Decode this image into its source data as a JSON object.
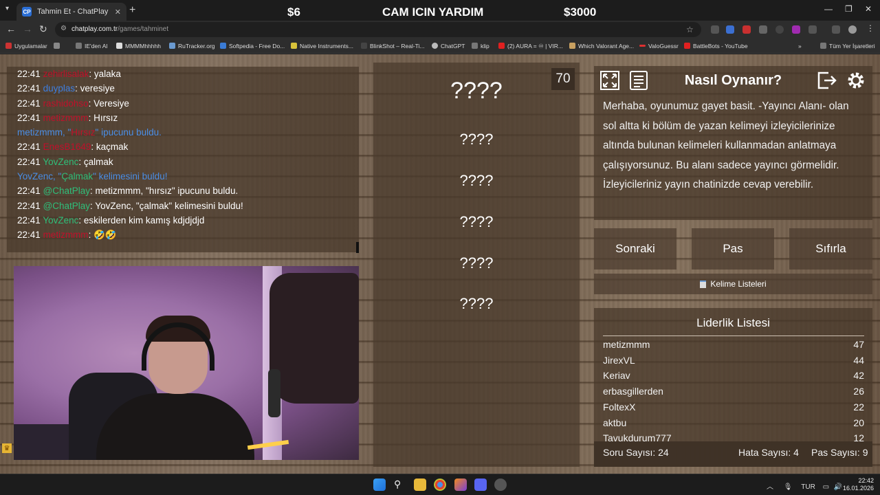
{
  "browser": {
    "tab_title": "Tahmin Et - ChatPlay",
    "tab_favicon": "CP",
    "url_host": "chatplay.com.tr",
    "url_path": "/games/tahminet",
    "bookmarks": [
      "Uygulamalar",
      "IE'den Al",
      "MMMMhhhhh",
      "RuTracker.org",
      "Softpedia - Free Do...",
      "Native Instruments...",
      "BlinkShot – Real-Ti...",
      "ChatGPT",
      "klip",
      "(2) AURA = ♾ | VIR...",
      "Which Valorant Age...",
      "ValoGuessr",
      "BattleBots - YouTube",
      "Tüm Yer İşaretleri"
    ]
  },
  "stream_overlay": {
    "left": "$6",
    "center": "CAM ICIN YARDIM",
    "right": "$3000"
  },
  "chat": [
    {
      "time": "22:41",
      "user": "zehirlisalak",
      "user_color": "#c0102a",
      "text": ": yalaka"
    },
    {
      "time": "22:41",
      "user": "duyplas",
      "user_color": "#3d7ee0",
      "text": ": veresiye"
    },
    {
      "time": "22:41",
      "user": "rashidohso",
      "user_color": "#c0102a",
      "text": ": Veresiye"
    },
    {
      "time": "22:41",
      "user": "metizmmm",
      "user_color": "#c0102a",
      "text": ": Hırsız"
    },
    {
      "system": true,
      "parts": [
        "metizmmm, \"",
        "Hırsız",
        "\" ipucunu buldu."
      ]
    },
    {
      "time": "22:41",
      "user": "EnesB1649",
      "user_color": "#c0102a",
      "text": ": kaçmak"
    },
    {
      "time": "22:41",
      "user": "YovZenc",
      "user_color": "#2fbf7a",
      "text": ": çalmak"
    },
    {
      "system": true,
      "parts": [
        "YovZenc, \"",
        "Çalmak",
        "\" kelimesini buldu!"
      ]
    },
    {
      "time": "22:41",
      "user": "@ChatPlay",
      "user_color": "#2fbf7a",
      "text": ": metizmmm, \"hırsız\" ipucunu buldu."
    },
    {
      "time": "22:41",
      "user": "@ChatPlay",
      "user_color": "#2fbf7a",
      "text": ": YovZenc, \"çalmak\" kelimesini buldu!"
    },
    {
      "time": "22:41",
      "user": "YovZenc",
      "user_color": "#2fbf7a",
      "text": ": eskilerden kim kamış kdjdjdjd"
    },
    {
      "time": "22:41",
      "user": "metizmmm",
      "user_color": "#c0102a",
      "text": ": 🤣🤣"
    }
  ],
  "game": {
    "timer": "70",
    "main_word": "????",
    "hints": [
      "????",
      "????",
      "????",
      "????",
      "????"
    ]
  },
  "howto": {
    "title": "Nasıl Oynanır?",
    "text": "Merhaba, oyunumuz gayet basit. -Yayıncı Alanı- olan sol altta ki bölüm de yazan kelimeyi izleyicilerinize altında bulunan kelimeleri kullanmadan anlatmaya çalışıyorsunuz. Bu alanı sadece yayıncı görmelidir. İzleyicileriniz yayın chatinizde cevap verebilir."
  },
  "controls": {
    "next": "Sonraki",
    "pass": "Pas",
    "reset": "Sıfırla",
    "word_lists": "Kelime Listeleri"
  },
  "leaderboard": {
    "title": "Liderlik Listesi",
    "rows": [
      {
        "name": "metizmmm",
        "score": "47"
      },
      {
        "name": "JirexVL",
        "score": "44"
      },
      {
        "name": "Keriav",
        "score": "42"
      },
      {
        "name": "erbasgillerden",
        "score": "26"
      },
      {
        "name": "FoltexX",
        "score": "22"
      },
      {
        "name": "aktbu",
        "score": "20"
      },
      {
        "name": "Tavukdurum777",
        "score": "12"
      }
    ],
    "questions": "Soru Sayısı: 24",
    "errors": "Hata Sayısı: 4",
    "passes": "Pas Sayısı: 9"
  },
  "taskbar": {
    "lang": "TUR",
    "time": "22:42",
    "date": "16.01.2026"
  },
  "colors": {
    "system_msg": "#4a8ee6",
    "windows_blue": "#3aa0f5",
    "chrome_red": "#e0442f"
  }
}
